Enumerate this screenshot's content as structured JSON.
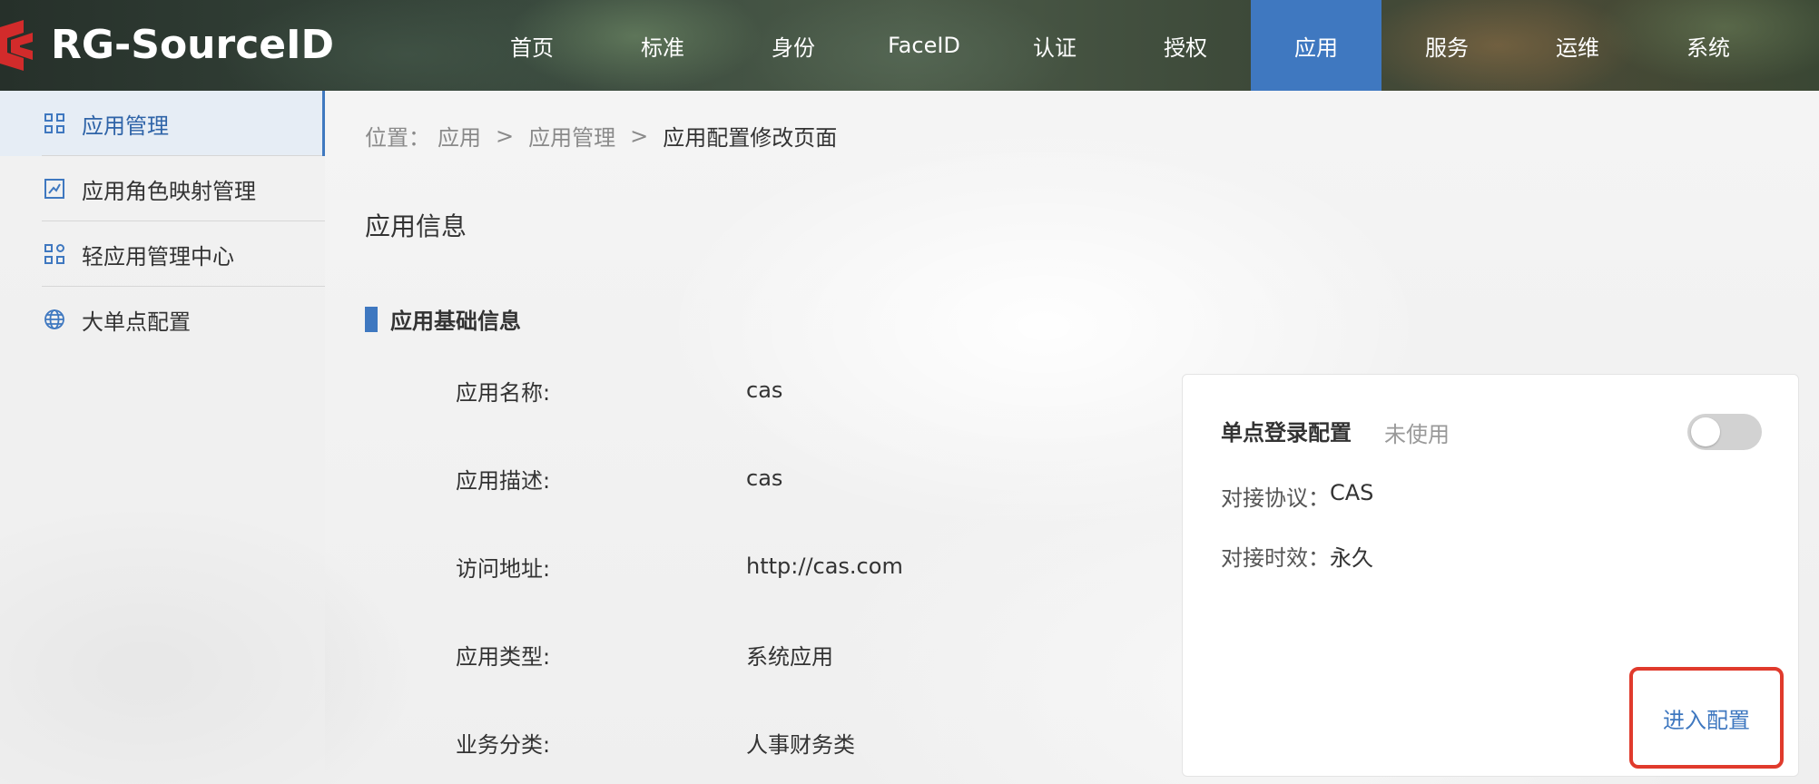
{
  "app": {
    "logo_text": "RG-SourceID"
  },
  "nav": {
    "items": [
      {
        "label": "首页"
      },
      {
        "label": "标准"
      },
      {
        "label": "身份"
      },
      {
        "label": "FaceID"
      },
      {
        "label": "认证"
      },
      {
        "label": "授权"
      },
      {
        "label": "应用",
        "active": true
      },
      {
        "label": "服务"
      },
      {
        "label": "运维"
      },
      {
        "label": "系统"
      }
    ]
  },
  "sidebar": {
    "items": [
      {
        "label": "应用管理",
        "icon": "grid-icon",
        "active": true
      },
      {
        "label": "应用角色映射管理",
        "icon": "chart-box-icon"
      },
      {
        "label": "轻应用管理中心",
        "icon": "apps-icon"
      },
      {
        "label": "大单点配置",
        "icon": "globe-icon"
      }
    ]
  },
  "breadcrumb": {
    "prefix": "位置：",
    "items": [
      "应用",
      "应用管理"
    ],
    "separator": ">",
    "current": "应用配置修改页面"
  },
  "main": {
    "section_title": "应用信息",
    "subsection_title": "应用基础信息",
    "fields": [
      {
        "key": "应用名称:",
        "value": "cas"
      },
      {
        "key": "应用描述:",
        "value": "cas"
      },
      {
        "key": "访问地址:",
        "value": "http://cas.com"
      },
      {
        "key": "应用类型:",
        "value": "系统应用"
      },
      {
        "key": "业务分类:",
        "value": "人事财务类"
      }
    ]
  },
  "sso_card": {
    "title": "单点登录配置",
    "status": "未使用",
    "toggle_on": false,
    "protocol_label": "对接协议：",
    "protocol_value": "CAS",
    "validity_label": "对接时效：",
    "validity_value": "永久",
    "enter_button": "进入配置"
  },
  "colors": {
    "accent": "#3f78c0",
    "highlight_border": "#e03a2c",
    "logo_red": "#d22b2b"
  }
}
